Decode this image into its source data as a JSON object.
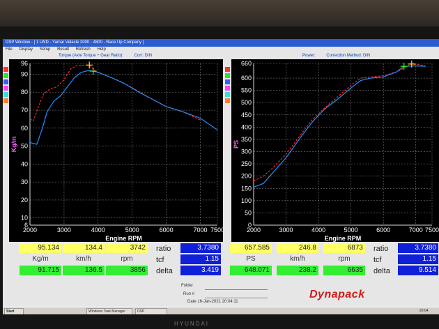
{
  "window": {
    "title": "DSP Window - [ 1 LWD - Yamar Velacle 2000 - 4800 - Race Up Company ]"
  },
  "menu": [
    "File",
    "Display",
    "Setup",
    "Result",
    "Refresh",
    "Help"
  ],
  "torque_header": {
    "title": "Torque (Axle Torque ÷ Gear Ratio):",
    "corr": "Corr: DIN"
  },
  "power_header": {
    "title": "Power:",
    "corr": "Correction Method: DIN"
  },
  "colors": {
    "run1": "#ff2020",
    "run2": "#2090ff",
    "plot_bg": "#000000",
    "grid": "#7a7a7a"
  },
  "sidebar_colors": [
    "#ff3030",
    "#30e030",
    "#3060ff",
    "#ff40ff",
    "#30e0e0",
    "#ff8030"
  ],
  "readout_left": {
    "run1": [
      "95.134",
      "134.4",
      "3742"
    ],
    "units": [
      "Kg/m",
      "km/h",
      "rpm"
    ],
    "run2": [
      "91.715",
      "136.5",
      "3856"
    ],
    "labels": [
      "ratio",
      "tcf",
      "delta"
    ],
    "values": [
      "3.7380",
      "1.15",
      "3.419"
    ]
  },
  "readout_right": {
    "run1": [
      "657.585",
      "246.8",
      "6873"
    ],
    "units": [
      "PS",
      "km/h",
      "rpm"
    ],
    "run2": [
      "648.071",
      "238.2",
      "6635"
    ],
    "labels": [
      "ratio",
      "tcf",
      "delta"
    ],
    "values": [
      "3.7380",
      "1.15",
      "9.514"
    ]
  },
  "footer": {
    "folder_label": "Folder",
    "run_label": "Run #",
    "date_text": "Date 16-Jan-2021 20:04:11",
    "logo": "Dynapack"
  },
  "taskbar": {
    "start": "Start",
    "tasks": [
      "Windows Task Manager",
      "DSP"
    ],
    "clock": "20:04"
  },
  "monitor_brand": "HYUNDAI",
  "chart_data": [
    {
      "type": "line",
      "xlabel": "Engine RPM",
      "ylabel": "Kg/m",
      "xlim": [
        2000,
        7500
      ],
      "ylim": [
        6,
        96
      ],
      "xticks": [
        2000,
        3000,
        4000,
        5000,
        6000,
        7000,
        7500
      ],
      "yticks": [
        6,
        10,
        20,
        30,
        40,
        50,
        60,
        70,
        80,
        90,
        96
      ],
      "grid": true,
      "series": [
        {
          "color": "#ff2020",
          "dashed": true,
          "x": [
            2000,
            2100,
            2250,
            2400,
            2600,
            2800,
            3000,
            3200,
            3400,
            3600,
            3742,
            3900,
            4200,
            4600,
            5000,
            5500,
            6000,
            6500,
            7000
          ],
          "y": [
            65,
            64,
            72,
            79,
            82,
            83,
            87,
            93,
            95,
            95,
            95.1,
            92,
            89.5,
            86.5,
            82.5,
            77,
            72,
            69,
            64.5
          ]
        },
        {
          "color": "#2090ff",
          "dashed": false,
          "x": [
            2000,
            2200,
            2350,
            2500,
            2700,
            2900,
            3100,
            3300,
            3500,
            3700,
            3856,
            4000,
            4400,
            4800,
            5200,
            5600,
            6000,
            6500,
            7000,
            7500
          ],
          "y": [
            52,
            51,
            59,
            69,
            75,
            78,
            83,
            88,
            91,
            92,
            91.7,
            91,
            88,
            84.5,
            80,
            76,
            72,
            69,
            65.5,
            59
          ]
        }
      ],
      "markers": [
        {
          "x": 3742,
          "y": 95.1,
          "color": "#ffe020"
        },
        {
          "x": 3856,
          "y": 91.7,
          "color": "#30ff30"
        }
      ]
    },
    {
      "type": "line",
      "xlabel": "Engine RPM",
      "ylabel": "PS",
      "xlim": [
        2000,
        7500
      ],
      "ylim": [
        0,
        660
      ],
      "xticks": [
        2000,
        3000,
        4000,
        5000,
        6000,
        7000,
        7500
      ],
      "yticks": [
        0,
        50,
        100,
        150,
        200,
        250,
        300,
        350,
        400,
        450,
        500,
        550,
        600,
        660
      ],
      "grid": true,
      "series": [
        {
          "color": "#ff2020",
          "dashed": true,
          "x": [
            2000,
            2300,
            2600,
            3000,
            3400,
            3800,
            4200,
            4600,
            5000,
            5300,
            5600,
            6000,
            6400,
            6873,
            7100,
            7300
          ],
          "y": [
            180,
            200,
            235,
            290,
            360,
            430,
            480,
            525,
            570,
            600,
            605,
            610,
            625,
            657.6,
            655,
            650
          ]
        },
        {
          "color": "#2090ff",
          "dashed": false,
          "x": [
            2000,
            2300,
            2600,
            3000,
            3400,
            3800,
            4200,
            4600,
            5000,
            5300,
            5600,
            6000,
            6400,
            6635,
            7000,
            7300
          ],
          "y": [
            155,
            170,
            215,
            275,
            350,
            420,
            475,
            515,
            560,
            590,
            600,
            605,
            625,
            648.1,
            650,
            648
          ]
        }
      ],
      "markers": [
        {
          "x": 6635,
          "y": 648.1,
          "color": "#30ff30"
        },
        {
          "x": 6873,
          "y": 657.6,
          "color": "#ffe020"
        }
      ]
    }
  ]
}
